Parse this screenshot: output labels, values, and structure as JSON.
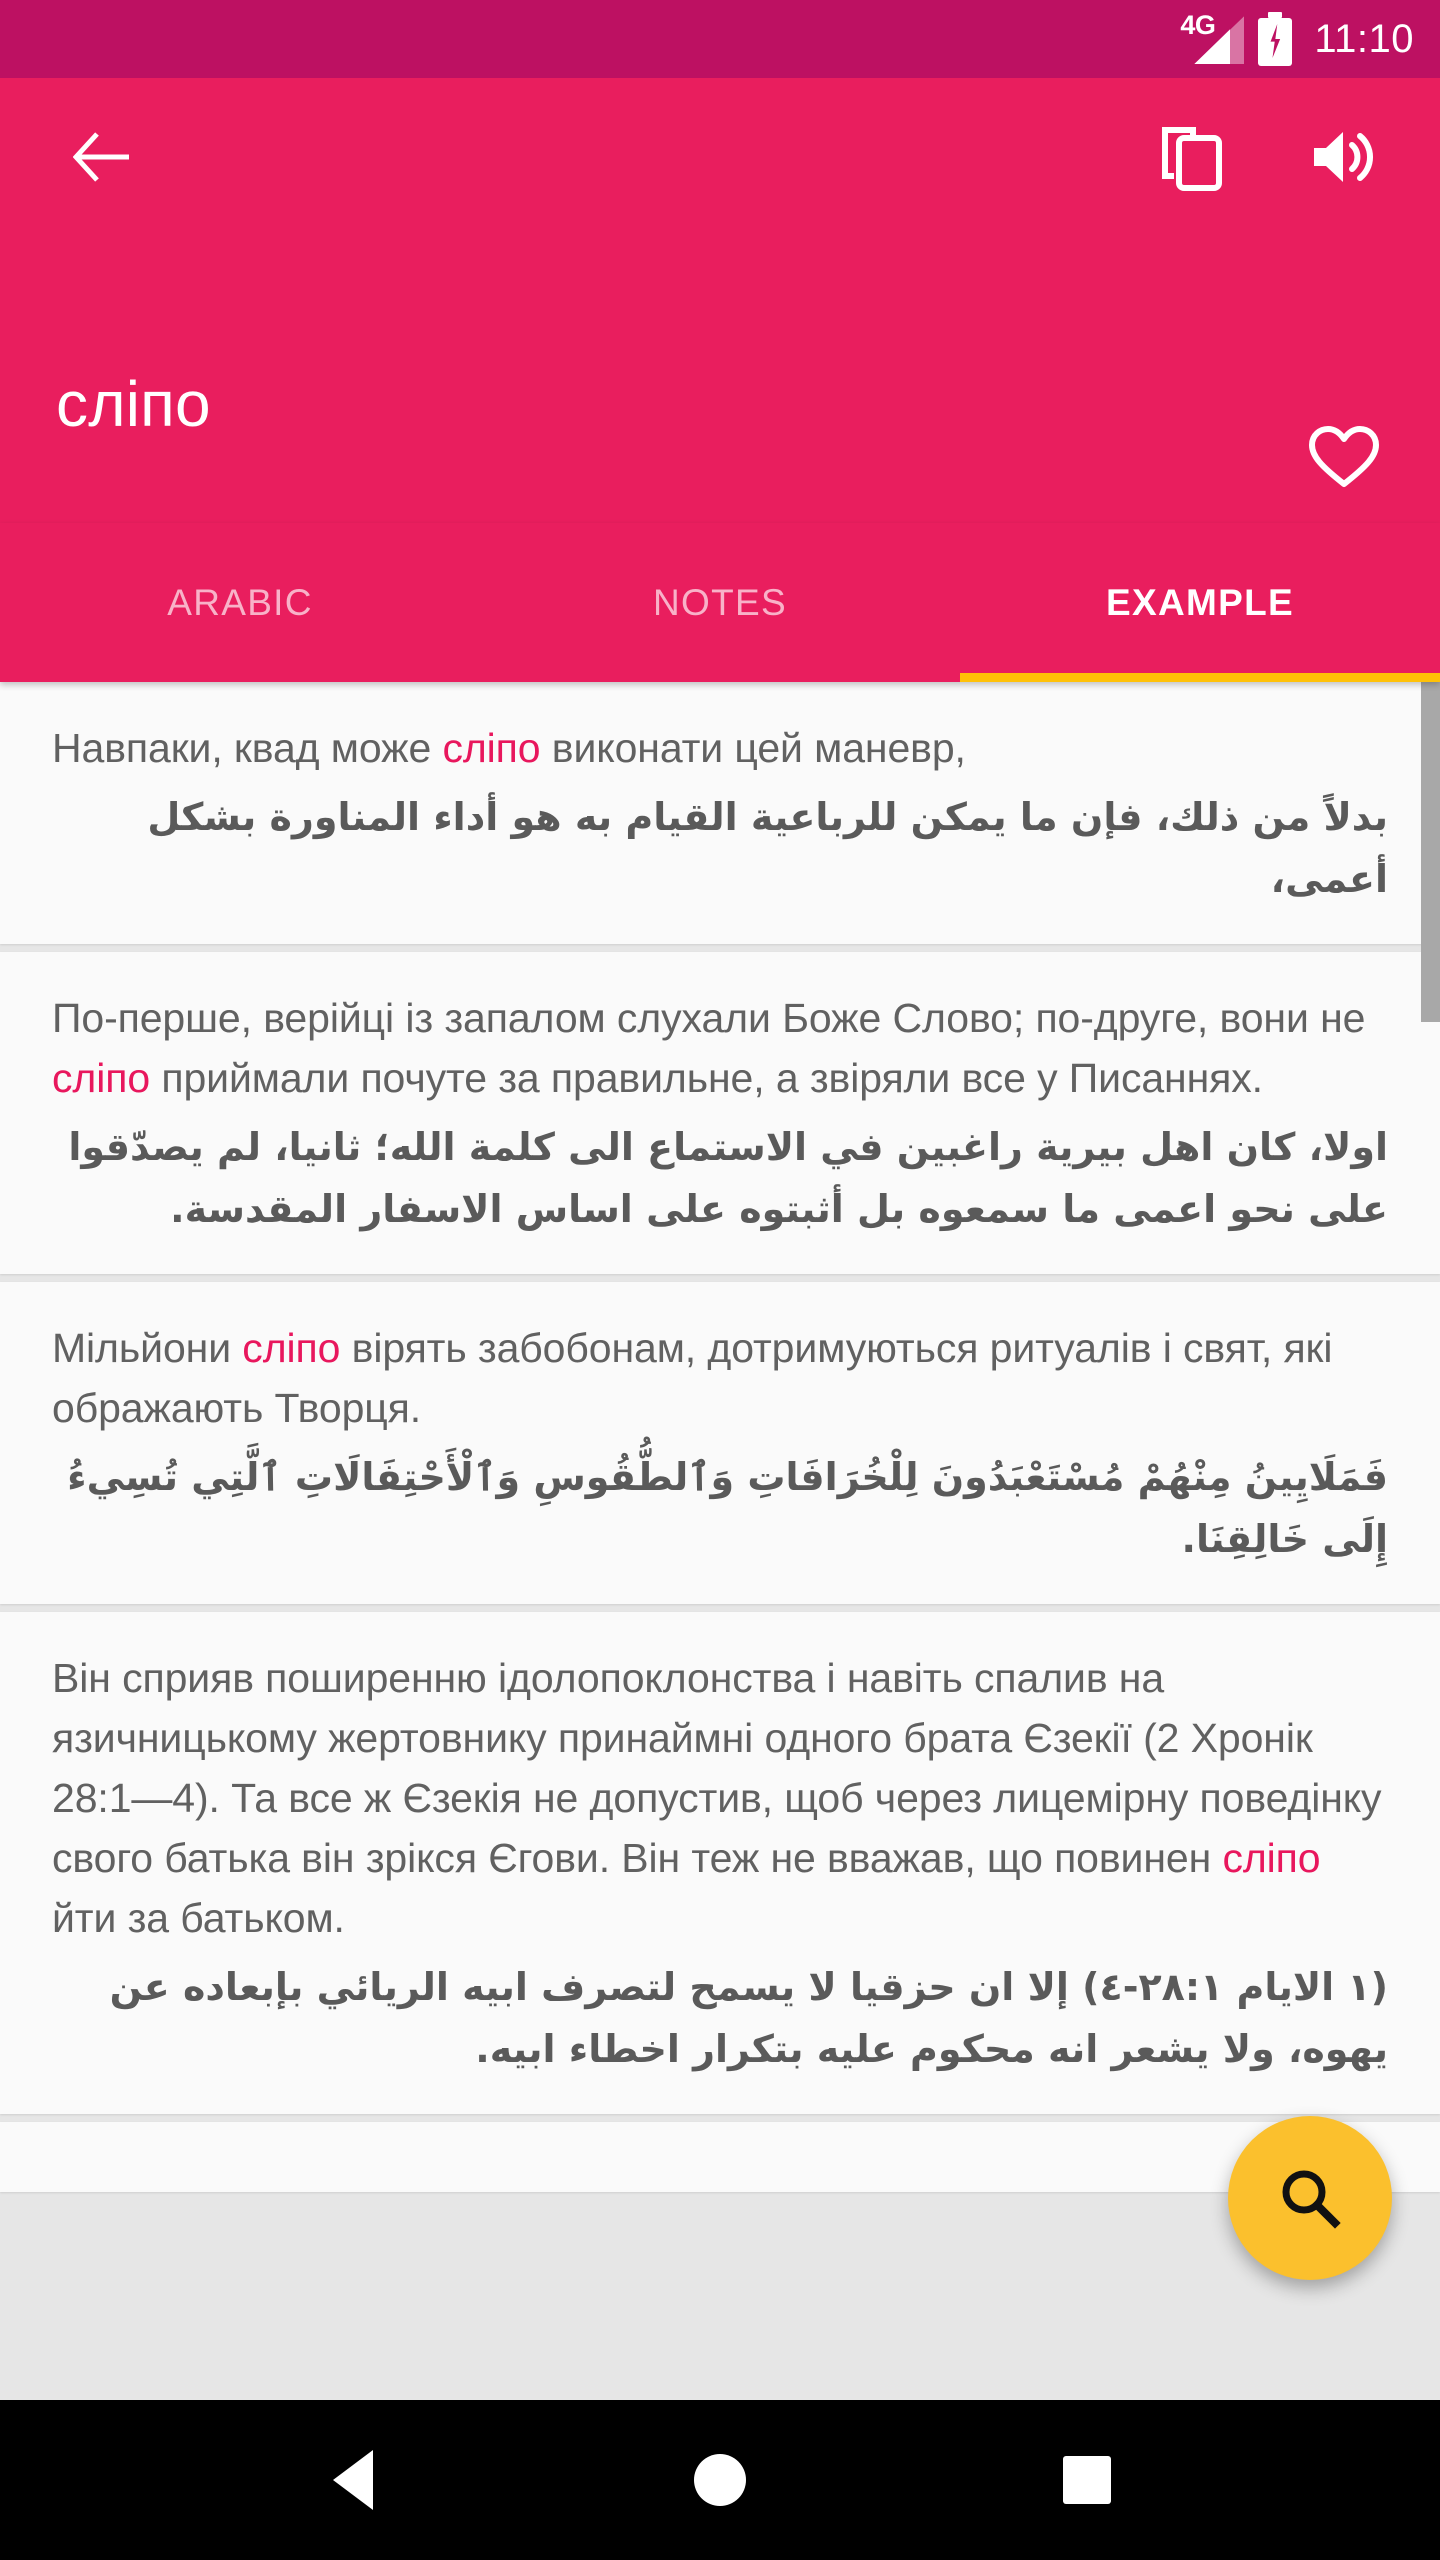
{
  "status_bar": {
    "network_label": "4G",
    "time": "11:10",
    "signal_icon": "signal-bars-icon",
    "battery_icon": "battery-charging-icon"
  },
  "app_bar": {
    "back_icon": "back-arrow-icon",
    "copy_icon": "copy-icon",
    "volume_icon": "volume-up-icon",
    "favorite_icon": "heart-outline-icon",
    "title": "сліпо"
  },
  "tabs": [
    {
      "label": "ARABIC",
      "active": false
    },
    {
      "label": "NOTES",
      "active": false
    },
    {
      "label": "EXAMPLE",
      "active": true
    }
  ],
  "colors": {
    "status_bar": "#bd1162",
    "app_bar": "#e91e5e",
    "tab_indicator": "#ffc107",
    "highlight": "#e8175d",
    "fab": "#fbc02d",
    "card_bg": "#fafafa",
    "body_text": "#616161"
  },
  "examples": [
    {
      "ukrainian_pre": "Навпаки, квад може ",
      "ukrainian_highlight": "сліпо",
      "ukrainian_post": " виконати цей маневр,",
      "arabic": "بدلاً من ذلك، فإن ما يمكن للرباعية القيام به هو أداء المناورة بشكل أعمى،"
    },
    {
      "ukrainian_pre": "По-перше, верійці із запалом слухали Боже Слово; по-друге, вони не ",
      "ukrainian_highlight": "сліпо",
      "ukrainian_post": " приймали почуте за правильне, а звіряли все у Писаннях.",
      "arabic": "اولا، كان اهل بيرية راغبين في الاستماع الى كلمة الله؛ ثانيا، لم يصدّقوا على نحو اعمى ما سمعوه بل أثبتوه على اساس الاسفار المقدسة."
    },
    {
      "ukrainian_pre": "Мільйони ",
      "ukrainian_highlight": "сліпо",
      "ukrainian_post": " вірять забобонам, дотримуються ритуалів і свят, які ображають Творця.",
      "arabic": "فَمَلَايِينُ مِنْهُمْ مُسْتَعْبَدُونَ لِلْخُرَافَاتِ وَٱلطُّقُوسِ وَٱلْأَحْتِفَالَاتِ ٱلَّتِي تُسِيءُ إِلَى خَالِقِنَا."
    },
    {
      "ukrainian_pre": "Він сприяв поширенню ідолопоклонства і навіть спалив на язичницькому жертовнику принаймні одного брата Єзекії (2 Хронік 28:1—4). Та все ж Єзекія не допустив, щоб через лицемірну поведінку свого батька він зрікся Єгови. Він теж не вважав, що повинен ",
      "ukrainian_highlight": "сліпо",
      "ukrainian_post": " йти за батьком.",
      "arabic": "(١ الايام ٢٨:١-٤) إلا ان حزقيا لا يسمح لتصرف ابيه الريائي بإبعاده عن يهوه، ولا يشعر انه محكوم عليه بتكرار اخطاء ابيه."
    }
  ],
  "fab": {
    "icon": "search-icon",
    "label": "Search"
  },
  "nav_bar": {
    "back": "nav-back-icon",
    "home": "nav-home-icon",
    "recents": "nav-recents-icon"
  }
}
